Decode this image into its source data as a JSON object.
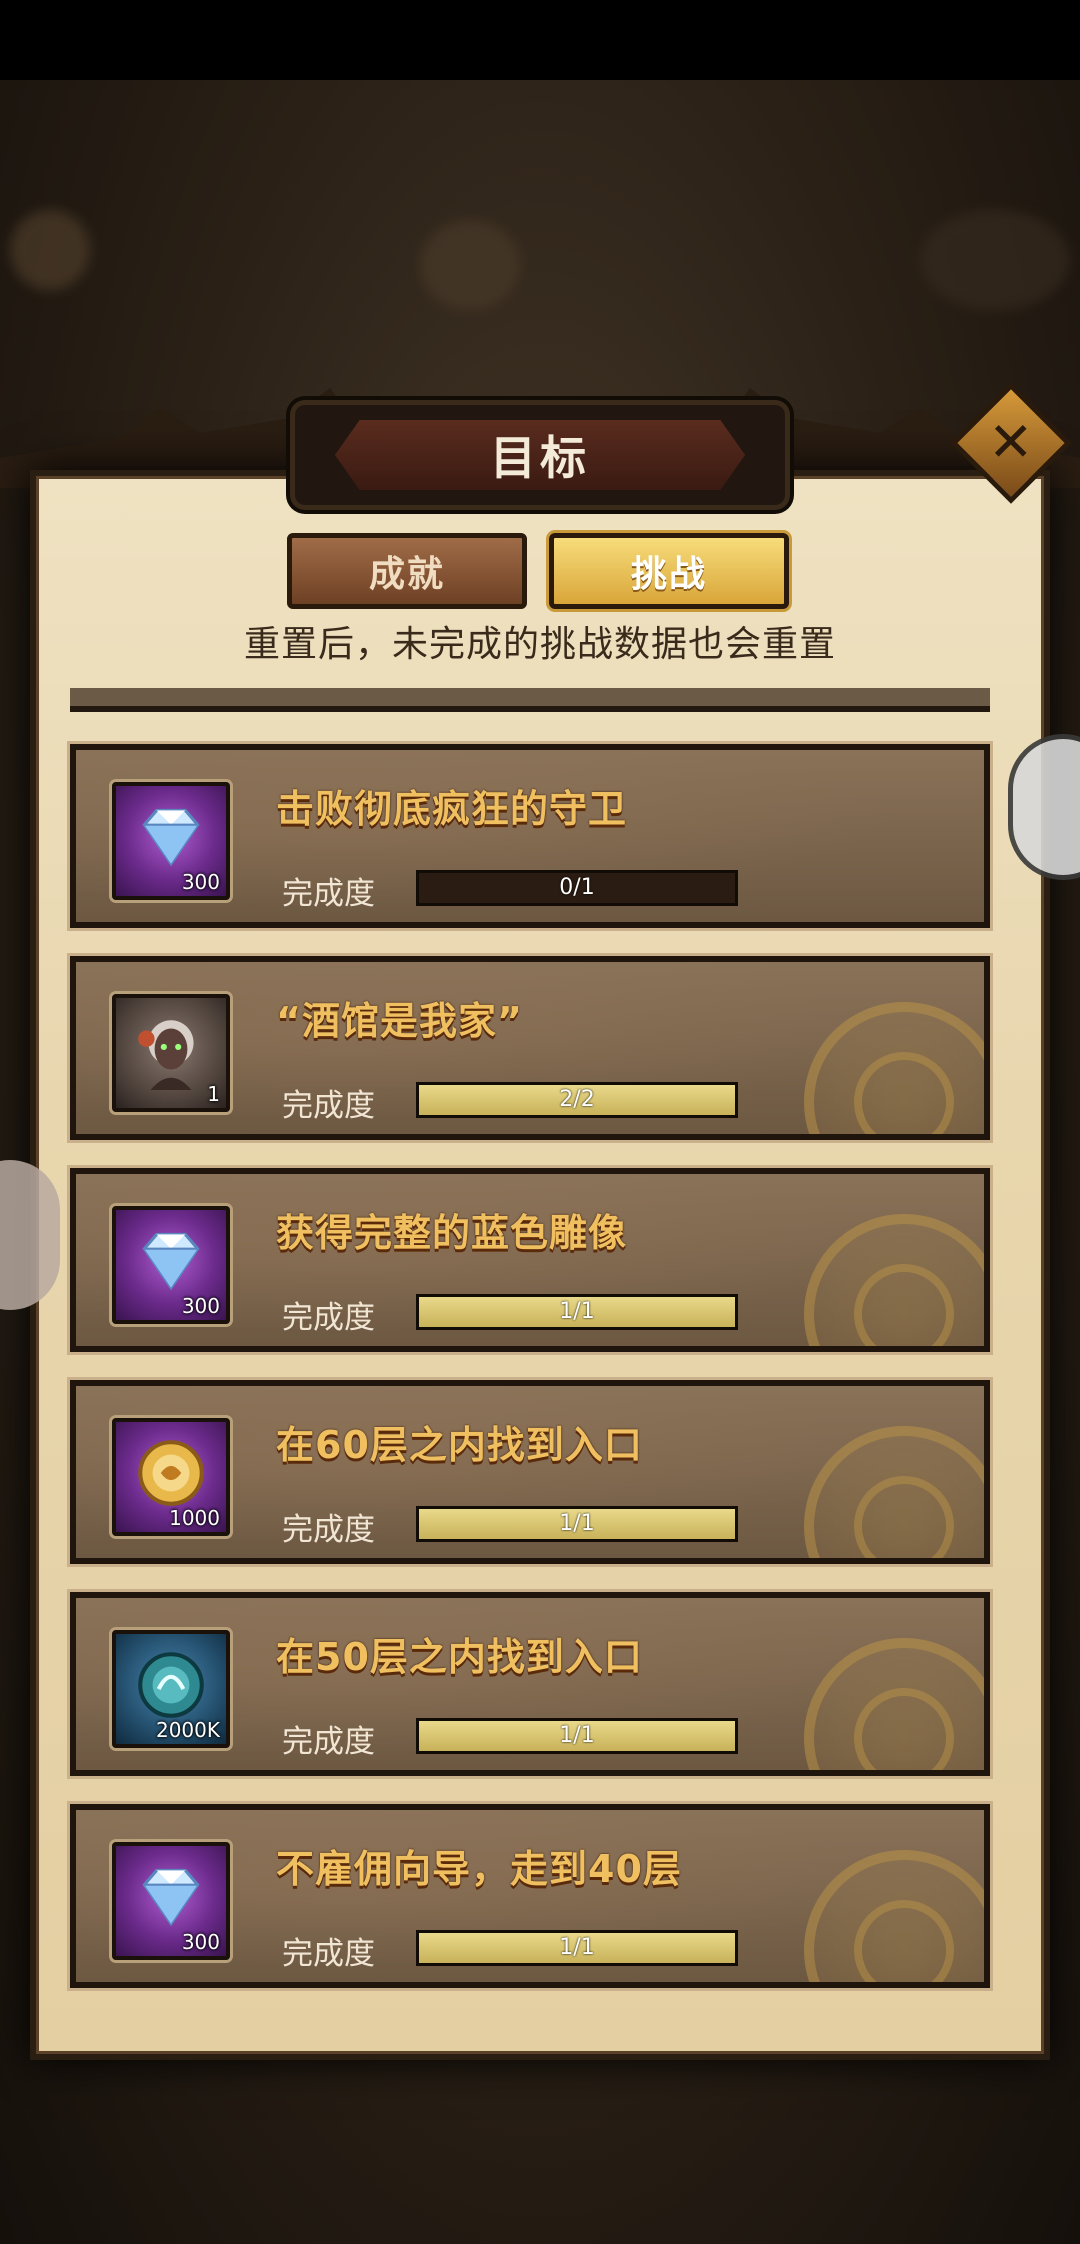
{
  "header": {
    "title": "目标",
    "close_icon": "close-icon"
  },
  "tabs": [
    {
      "label": "成就",
      "active": false
    },
    {
      "label": "挑战",
      "active": true
    }
  ],
  "notice": "重置后，未完成的挑战数据也会重置",
  "progress_label": "完成度",
  "challenges": [
    {
      "title": "击败彻底疯狂的守卫",
      "icon": "diamond-icon",
      "icon_bg": "purple",
      "quantity": "300",
      "progress_text": "0/1",
      "progress_fraction": 0.0,
      "completed": false
    },
    {
      "title": "“酒馆是我家”",
      "icon": "hero-portrait-icon",
      "icon_bg": "gray",
      "quantity": "1",
      "progress_text": "2/2",
      "progress_fraction": 1.0,
      "completed": true
    },
    {
      "title": "获得完整的蓝色雕像",
      "icon": "diamond-icon",
      "icon_bg": "purple",
      "quantity": "300",
      "progress_text": "1/1",
      "progress_fraction": 1.0,
      "completed": true
    },
    {
      "title": "在60层之内找到入口",
      "icon": "gold-orb-icon",
      "icon_bg": "purple",
      "quantity": "1000",
      "progress_text": "1/1",
      "progress_fraction": 1.0,
      "completed": true
    },
    {
      "title": "在50层之内找到入口",
      "icon": "spirit-orb-icon",
      "icon_bg": "blue",
      "quantity": "2000K",
      "progress_text": "1/1",
      "progress_fraction": 1.0,
      "completed": true
    },
    {
      "title": "不雇佣向导，走到40层",
      "icon": "diamond-icon",
      "icon_bg": "purple",
      "quantity": "300",
      "progress_text": "1/1",
      "progress_fraction": 1.0,
      "completed": true
    }
  ],
  "colors": {
    "title_gold": "#f0c060",
    "progress_fill": "#d9c470",
    "panel_bg": "#e8d6ae"
  }
}
